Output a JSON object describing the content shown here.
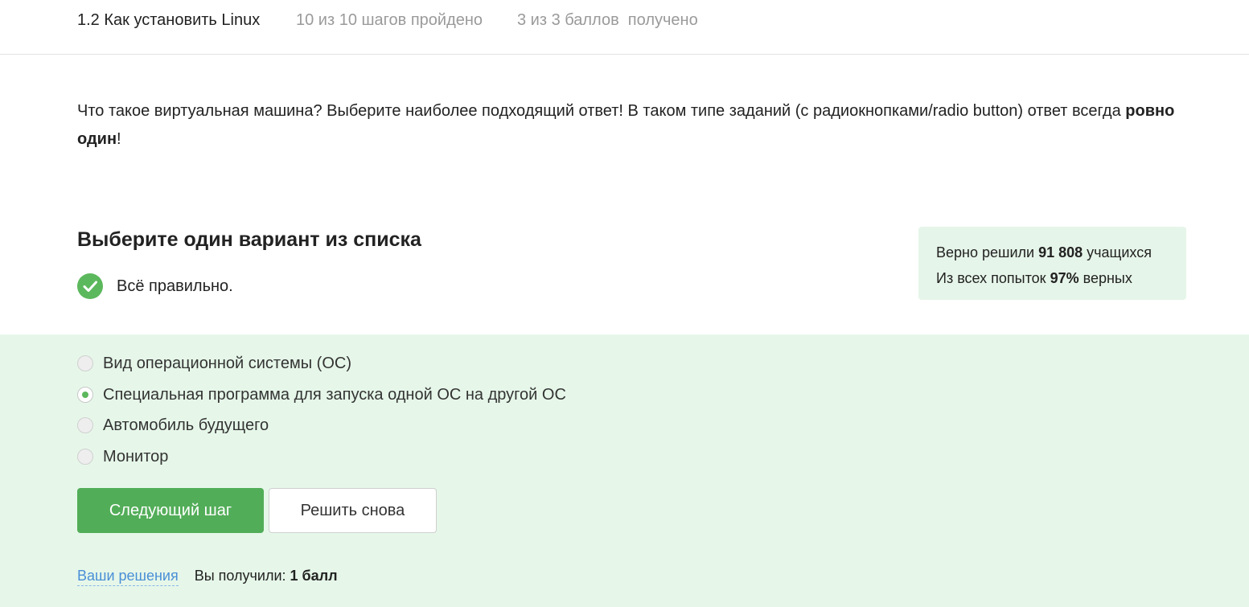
{
  "header": {
    "lesson_title": "1.2 Как установить Linux",
    "steps_progress": "10 из 10 шагов пройдено",
    "points_progress": "3 из 3 баллов  получено"
  },
  "question": {
    "text_before": "Что такое виртуальная машина? Выберите наиболее подходящий ответ! В таком типе заданий (с радиокнопками/radio button) ответ всегда ",
    "text_bold": "ровно один",
    "text_after": "!"
  },
  "quiz": {
    "title": "Выберите один вариант из списка",
    "result_text": "Всё правильно.",
    "result_icon": "check-circle-icon",
    "options": [
      {
        "label": "Вид операционной системы (ОС)",
        "checked": false
      },
      {
        "label": "Специальная программа для запуска одной ОС на другой ОС",
        "checked": true
      },
      {
        "label": "Автомобиль будущего",
        "checked": false
      },
      {
        "label": "Монитор",
        "checked": false
      }
    ],
    "next_button": "Следующий шаг",
    "retry_button": "Решить снова"
  },
  "stats": {
    "solved_prefix": "Верно решили",
    "solved_count": "91 808",
    "solved_suffix": "учащихся",
    "attempts_prefix": "Из всех попыток",
    "attempts_percent": "97%",
    "attempts_suffix": "верных"
  },
  "footer": {
    "solutions_link": "Ваши решения",
    "score_label": "Вы получили:",
    "score_value": "1 балл"
  },
  "colors": {
    "accent_green": "#52ad58",
    "answer_bg": "#e6f7e9",
    "link_blue": "#4a8fd6"
  }
}
